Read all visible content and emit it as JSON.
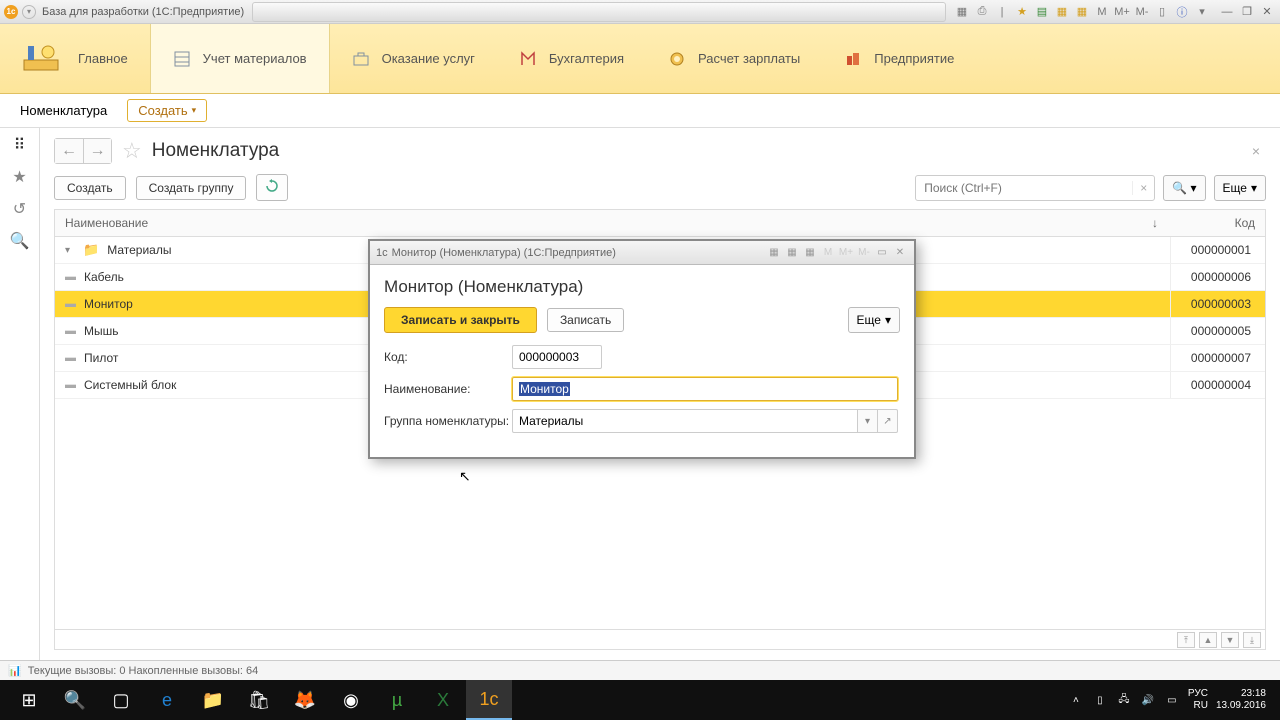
{
  "window": {
    "title": "База для разработки  (1С:Предприятие)"
  },
  "sections": {
    "main": "Главное",
    "materials": "Учет материалов",
    "services": "Оказание услуг",
    "accounting": "Бухгалтерия",
    "payroll": "Расчет зарплаты",
    "enterprise": "Предприятие"
  },
  "subnav": {
    "breadcrumb": "Номенклатура",
    "create": "Создать"
  },
  "page": {
    "title": "Номенклатура",
    "create": "Создать",
    "create_group": "Создать группу",
    "search_placeholder": "Поиск (Ctrl+F)",
    "more": "Еще"
  },
  "grid": {
    "header_name": "Наименование",
    "header_code": "Код",
    "rows": [
      {
        "name": "Материалы",
        "code": "000000001",
        "type": "folder"
      },
      {
        "name": "Кабель",
        "code": "000000006",
        "type": "item"
      },
      {
        "name": "Монитор",
        "code": "000000003",
        "type": "item",
        "selected": true
      },
      {
        "name": "Мышь",
        "code": "000000005",
        "type": "item"
      },
      {
        "name": "Пилот",
        "code": "000000007",
        "type": "item"
      },
      {
        "name": "Системный блок",
        "code": "000000004",
        "type": "item"
      }
    ]
  },
  "dialog": {
    "titlebar": "Монитор (Номенклатура)  (1С:Предприятие)",
    "heading": "Монитор (Номенклатура)",
    "save_close": "Записать и закрыть",
    "save": "Записать",
    "more": "Еще",
    "label_code": "Код:",
    "value_code": "000000003",
    "label_name": "Наименование:",
    "value_name": "Монитор",
    "label_group": "Группа номенклатуры:",
    "value_group": "Материалы"
  },
  "status": {
    "text": "Текущие вызовы: 0  Накопленные вызовы: 64"
  },
  "tray": {
    "lang1": "РУС",
    "lang2": "RU",
    "time": "23:18",
    "date": "13.09.2016"
  },
  "titlebar_badges": {
    "m": "M",
    "mplus": "M+",
    "mminus": "M-"
  }
}
